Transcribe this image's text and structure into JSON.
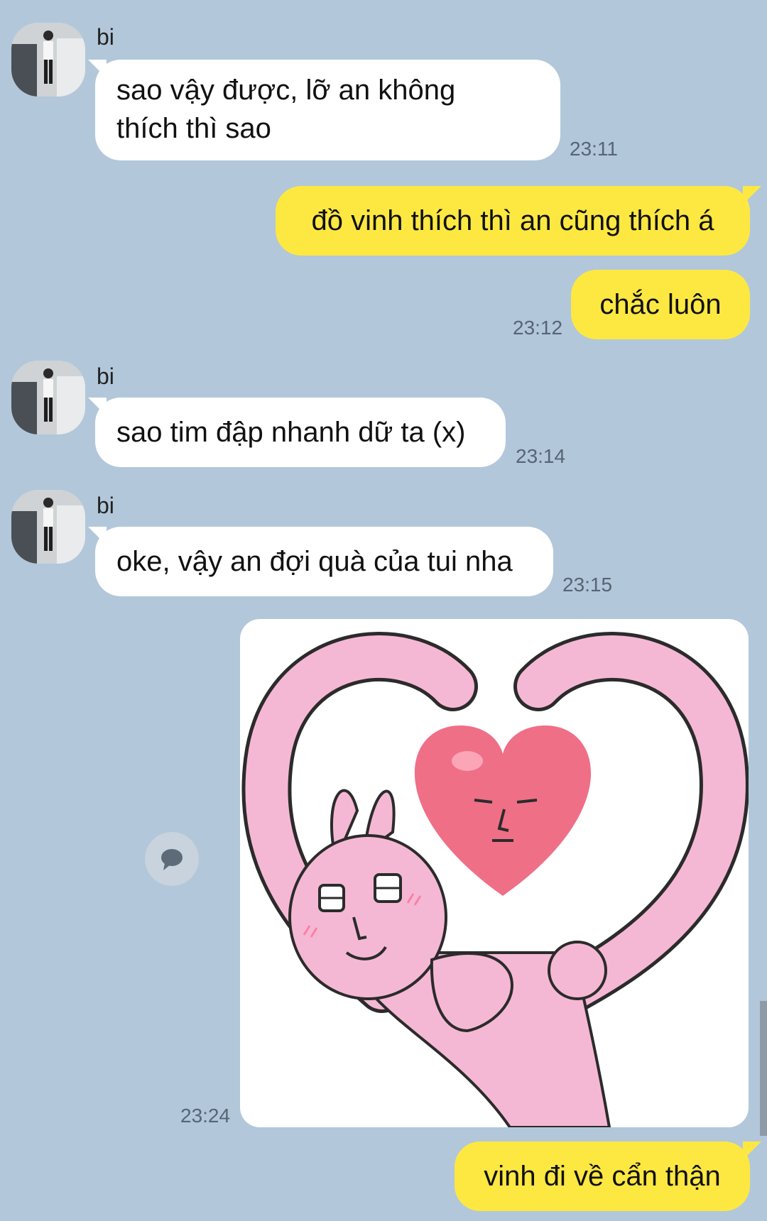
{
  "messages": [
    {
      "sender": "bi",
      "lines": [
        "sao vậy được, lỡ an không",
        "thích thì sao"
      ],
      "time": "23:11"
    },
    {
      "text": "đồ vinh thích thì an cũng thích á"
    },
    {
      "text": "chắc luôn",
      "time": "23:12"
    },
    {
      "sender": "bi",
      "text": "sao tim đập nhanh dữ ta (x)",
      "time": "23:14"
    },
    {
      "sender": "bi",
      "text": "oke, vậy an đợi quà của tui nha",
      "time": "23:15"
    },
    {
      "sticker": "pink-bunny-heart-sticker",
      "time": "23:24"
    },
    {
      "text": "vinh đi về cẩn thận"
    }
  ],
  "colors": {
    "background": "#b2c7da",
    "incoming_bubble": "#ffffff",
    "outgoing_bubble": "#fde842",
    "time_text": "#566574",
    "sticker_pink": "#f5b8d4",
    "heart_red": "#ef6f87"
  },
  "icons": {
    "reply": "speech-bubble-icon"
  }
}
